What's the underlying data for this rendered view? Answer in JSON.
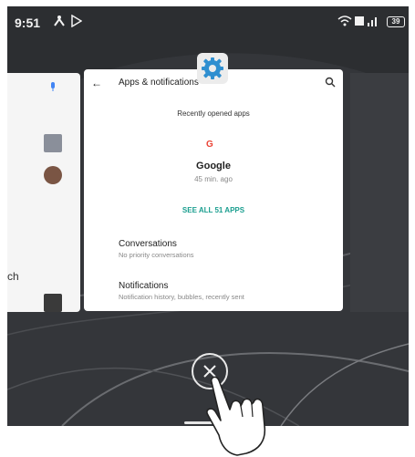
{
  "status_bar": {
    "time": "9:51",
    "battery": "39"
  },
  "main_card": {
    "title": "Apps & notifications",
    "recent_label": "Recently opened apps",
    "recent_app": {
      "icon": "G",
      "name": "Google",
      "time": "45 min. ago"
    },
    "see_all_label": "SEE ALL 51 APPS",
    "rows": [
      {
        "title": "Conversations",
        "subtitle": "No priority conversations"
      },
      {
        "title": "Notifications",
        "subtitle": "Notification history, bubbles, recently sent"
      }
    ]
  },
  "left_card": {
    "partial_text": "ch"
  },
  "colors": {
    "accent": "#1a9e8f",
    "settings_icon": "#2f8fd0"
  }
}
